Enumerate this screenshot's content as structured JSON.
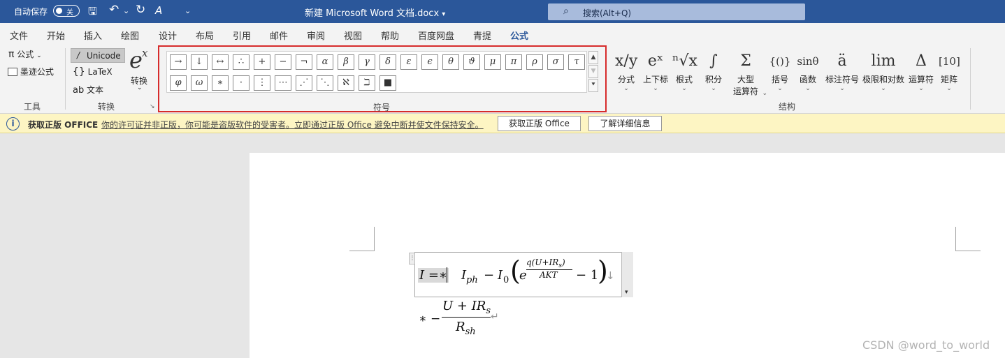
{
  "titlebar": {
    "autosave_label": "自动保存",
    "autosave_state": "关",
    "document_title": "新建 Microsoft Word 文档.docx",
    "title_dropdown": "▾",
    "search_placeholder": "搜索(Alt+Q)"
  },
  "qat": {
    "save": "🖫",
    "undo": "↶",
    "undo_chevron": "⌄",
    "redo": "↻",
    "format_painter": "A",
    "more": "⌄"
  },
  "tabs": [
    "文件",
    "开始",
    "插入",
    "绘图",
    "设计",
    "布局",
    "引用",
    "邮件",
    "审阅",
    "视图",
    "帮助",
    "百度网盘",
    "青提",
    "公式"
  ],
  "active_tab": "公式",
  "tools_group": {
    "equation_label": "公式",
    "equation_icon": "π",
    "ink_equation_label": "墨迹公式",
    "group_label": "工具"
  },
  "convert_group": {
    "unicode_label": "Unicode",
    "latex_label": "LaTeX",
    "text_label": "文本",
    "convert_label": "转换",
    "convert_glyph": "e",
    "convert_sup": "x",
    "group_label": "转换",
    "launcher": "↘"
  },
  "symbols_group": {
    "row1": [
      "→",
      "↓",
      "↔",
      "∴",
      "+",
      "−",
      "¬",
      "α",
      "β",
      "γ",
      "δ",
      "ε",
      "ϵ",
      "θ",
      "ϑ",
      "μ",
      "π",
      "ρ",
      "σ",
      "τ"
    ],
    "row2": [
      "φ",
      "ω",
      "∗",
      "·",
      "⋮",
      "⋯",
      "⋰",
      "⋱",
      "ℵ",
      "ℶ",
      "■"
    ],
    "scroll_up": "▲",
    "scroll_down": "▼",
    "expand": "⯆",
    "group_label": "符号"
  },
  "structures_group": {
    "items": [
      {
        "glyph": "x/y",
        "label": "分式"
      },
      {
        "glyph": "eˣ",
        "label": "上下标"
      },
      {
        "glyph": "ⁿ√x",
        "label": "根式"
      },
      {
        "glyph": "∫",
        "label": "积分"
      },
      {
        "glyph": "Σ",
        "label": "大型",
        "label2": "运算符"
      },
      {
        "glyph": "{()}",
        "label": "括号"
      },
      {
        "glyph": "sinθ",
        "label": "函数"
      },
      {
        "glyph": "ä",
        "label": "标注符号"
      },
      {
        "glyph": "lim",
        "label": "极限和对数"
      },
      {
        "glyph": "Δ",
        "label": "运算符"
      },
      {
        "glyph": "[10]",
        "label": "矩阵"
      }
    ],
    "chevron": "⌄",
    "group_label": "结构"
  },
  "infobar": {
    "icon": "i",
    "title": "获取正版 OFFICE",
    "message": "你的许可证并非正版，你可能是盗版软件的受害者。立即通过正版 Office 避免中断并使文件保持安全。",
    "button_genuine": "获取正版 Office",
    "button_learn_more": "了解详细信息"
  },
  "equation": {
    "line1": {
      "lhs": "I =∗",
      "term1": "I",
      "term1_sub": "ph",
      "minus": "−",
      "term2": "I",
      "term2_sub": "0",
      "paren_open": "(",
      "e": "e",
      "exp_num": "q(U+IR",
      "exp_num_sub": "s",
      "exp_num_close": ")",
      "exp_den": "AKT",
      "minus_one": "− 1",
      "paren_close": ")",
      "arrow": "↓"
    },
    "line2": {
      "prefix": "∗ −",
      "num": "U + IR",
      "num_sub": "s",
      "den": "R",
      "den_sub": "sh",
      "return_mark": "↵"
    },
    "handle": "⋮",
    "scroll_arrow": "▾"
  },
  "watermark": "CSDN @word_to_world"
}
